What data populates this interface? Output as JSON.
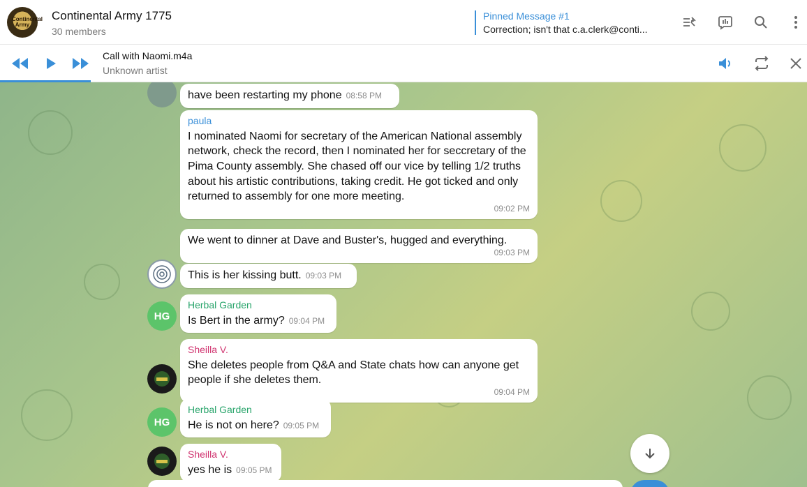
{
  "header": {
    "group_name": "Continental Army 1775",
    "members": "30 members",
    "avatar_text": "Continental Army",
    "pinned_title": "Pinned Message #1",
    "pinned_text": "Correction; isn't that c.a.clerk@conti..."
  },
  "player": {
    "track_title": "Call with Naomi.m4a",
    "track_artist": "Unknown artist"
  },
  "messages": [
    {
      "text": "have been  restarting my phone",
      "time": "08:58 PM"
    },
    {
      "sender": "paula",
      "text": "I nominated Naomi for secretary of the American National assembly network, check the record, then I nominated her for seccretary of the Pima County assembly. She chased off our vice by telling 1/2 truths about his artistic contributions, taking credit. He got ticked and only returned to assembly for one more meeting.",
      "time": "09:02 PM"
    },
    {
      "text": "We went to dinner at Dave and Buster's, hugged and everything.",
      "time": "09:03 PM"
    },
    {
      "text": "This is her kissing butt.",
      "time": "09:03 PM"
    },
    {
      "sender": "Herbal Garden",
      "avatar": "HG",
      "text": "Is Bert in the army?",
      "time": "09:04 PM"
    },
    {
      "sender": "Sheilla V.",
      "text": "She deletes people from Q&A and State chats how can anyone get people if she deletes them.",
      "time": "09:04 PM"
    },
    {
      "sender": "Herbal Garden",
      "avatar": "HG",
      "text": "He is not on here?",
      "time": "09:05 PM"
    },
    {
      "sender": "Sheilla V.",
      "text": "yes he is",
      "time": "09:05 PM"
    }
  ],
  "colors": {
    "accent": "#3a8fd8",
    "paula": "#3a8fd8",
    "herbal": "#2aa56c",
    "sheilla": "#d0336f",
    "hg_avatar": "#5cc46a"
  },
  "icons": [
    "pinned-list-icon",
    "poll-icon",
    "search-icon",
    "more-icon",
    "prev-icon",
    "play-icon",
    "next-icon",
    "volume-icon",
    "repeat-icon",
    "close-icon",
    "arrow-down-icon"
  ]
}
